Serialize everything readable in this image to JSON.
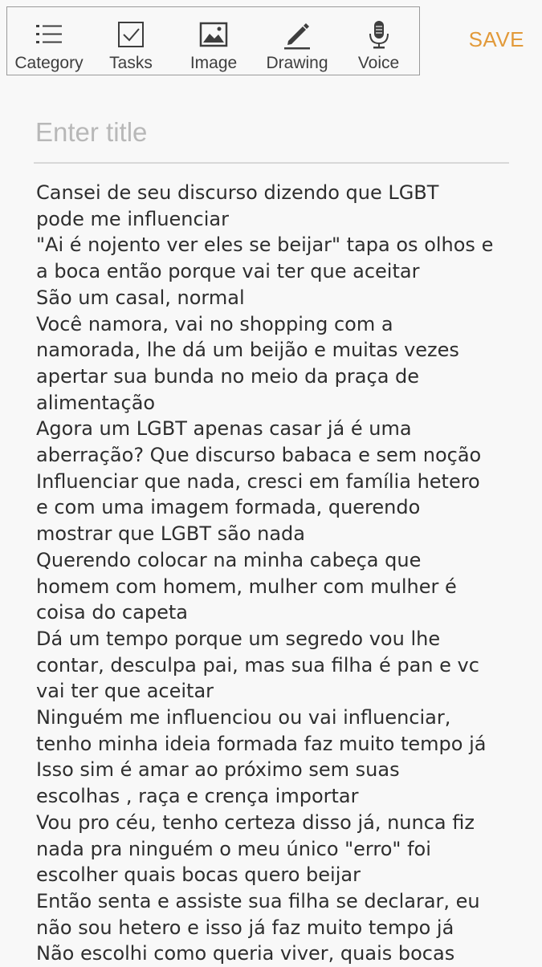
{
  "toolbar": {
    "items": [
      {
        "label": "Category",
        "icon": "list-icon"
      },
      {
        "label": "Tasks",
        "icon": "checkbox-icon"
      },
      {
        "label": "Image",
        "icon": "image-icon"
      },
      {
        "label": "Drawing",
        "icon": "pen-icon"
      },
      {
        "label": "Voice",
        "icon": "microphone-icon"
      }
    ],
    "save_label": "SAVE"
  },
  "title": {
    "placeholder": "Enter title",
    "value": ""
  },
  "body": {
    "lines": [
      "Cansei de seu discurso dizendo que LGBT",
      "pode me influenciar",
      "\"Ai é nojento ver eles se beijar\" tapa os olhos e",
      "a boca então porque vai ter que aceitar",
      "São um casal, normal",
      "Você namora, vai no shopping com a",
      "namorada, lhe dá um beijão e muitas vezes",
      "apertar sua bunda no meio da praça de",
      "alimentação",
      "Agora um LGBT apenas casar já é uma",
      "aberração? Que discurso babaca e sem noção",
      "Influenciar que nada, cresci em família hetero",
      "e com uma imagem formada, querendo",
      "mostrar que LGBT são nada",
      "Querendo colocar na minha cabeça que",
      "homem com homem, mulher com mulher é",
      "coisa do capeta",
      "Dá um tempo porque um segredo vou lhe",
      "contar, desculpa pai, mas sua filha é pan e vc",
      "vai ter que aceitar",
      "Ninguém me influenciou ou vai influenciar,",
      "tenho minha ideia formada faz muito tempo já",
      "Isso sim é amar ao próximo sem suas",
      "escolhas , raça e crença importar",
      "Vou pro céu, tenho certeza disso já, nunca fiz",
      "nada pra ninguém o meu único \"erro\" foi",
      "escolher quais bocas quero beijar",
      "Então senta e assiste sua filha se declarar, eu",
      "não sou hetero e isso já faz muito tempo já",
      "Não escolhi como queria viver, quais bocas"
    ]
  },
  "colors": {
    "background": "#f8f8f8",
    "accent": "#e29a3a",
    "placeholder": "#b8b8b8",
    "text": "#2e2e2e"
  }
}
